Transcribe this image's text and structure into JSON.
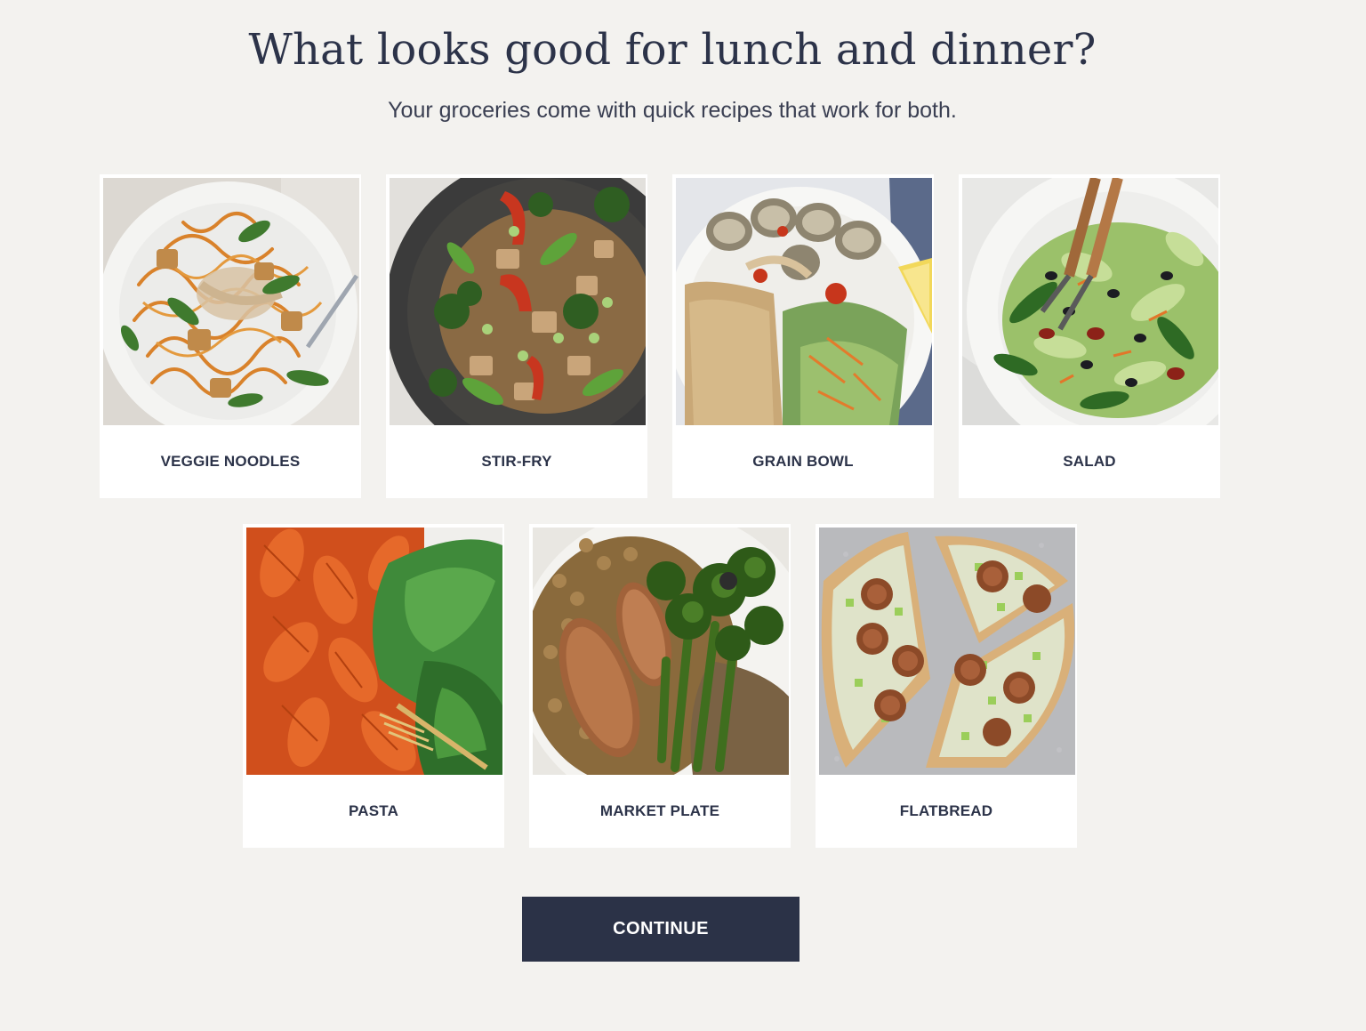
{
  "header": {
    "title": "What looks good for lunch and dinner?",
    "subtitle": "Your groceries come with quick recipes that work for both."
  },
  "options": [
    {
      "label": "VEGGIE NOODLES",
      "image": "veggie-noodles-photo"
    },
    {
      "label": "STIR-FRY",
      "image": "stir-fry-photo"
    },
    {
      "label": "GRAIN BOWL",
      "image": "grain-bowl-photo"
    },
    {
      "label": "SALAD",
      "image": "salad-photo"
    },
    {
      "label": "PASTA",
      "image": "pasta-photo"
    },
    {
      "label": "MARKET PLATE",
      "image": "market-plate-photo"
    },
    {
      "label": "FLATBREAD",
      "image": "flatbread-photo"
    }
  ],
  "actions": {
    "continue_label": "CONTINUE"
  },
  "colors": {
    "background": "#f3f2ef",
    "text": "#2c3349",
    "button": "#2b3247",
    "card": "#ffffff"
  }
}
